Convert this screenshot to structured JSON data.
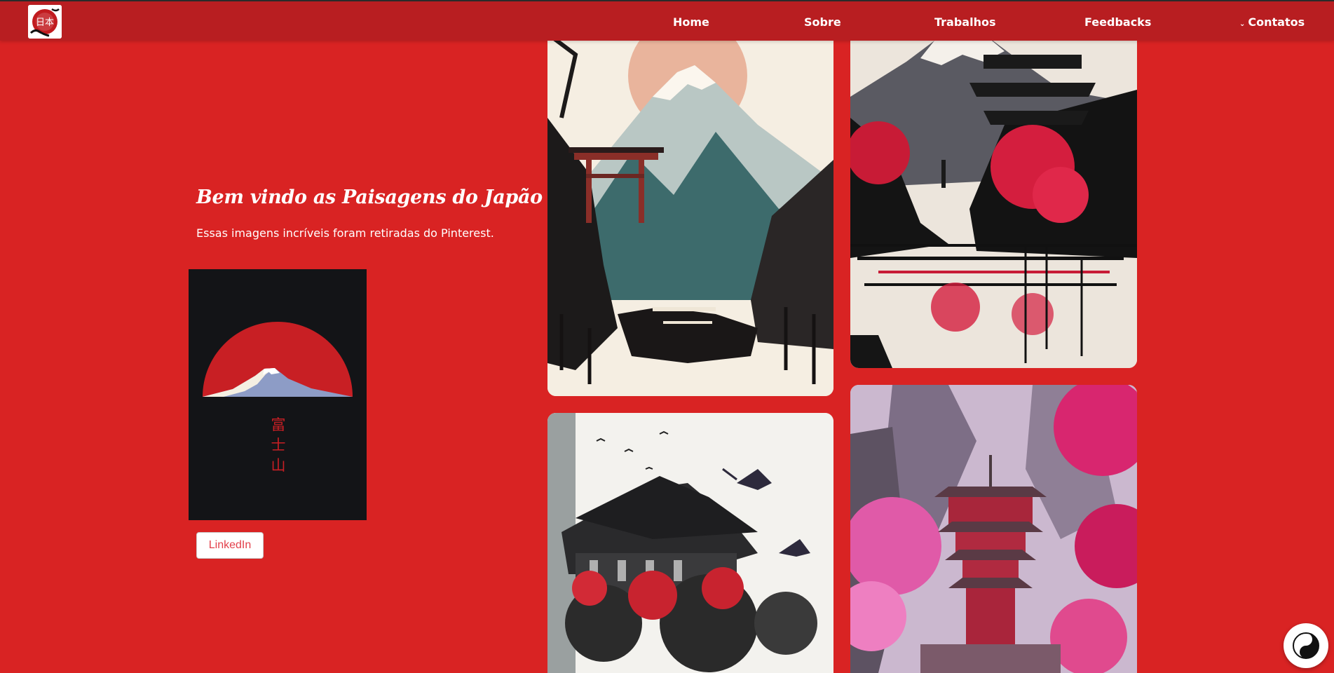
{
  "nav": {
    "logo_kanji": "日本",
    "links": [
      "Home",
      "Sobre",
      "Trabalhos",
      "Feedbacks"
    ],
    "contacts_label": "Contatos"
  },
  "hero": {
    "title": "Bem vindo as Paisagens do Japão",
    "subtitle": "Essas imagens incríveis foram retiradas do Pinterest.",
    "poster_kanji": [
      "富",
      "士",
      "山"
    ],
    "button_label": "LinkedIn"
  },
  "gallery": {
    "tiles": [
      {
        "subject": "torii-mountain-river-ink"
      },
      {
        "subject": "pagoda-red-trees-lake"
      },
      {
        "subject": "temple-cherry-blossom-birds"
      },
      {
        "subject": "pink-pagoda-mountains"
      }
    ]
  },
  "colors": {
    "background": "#d92323",
    "navbar": "#b81e21",
    "button_text": "#e3404b"
  }
}
